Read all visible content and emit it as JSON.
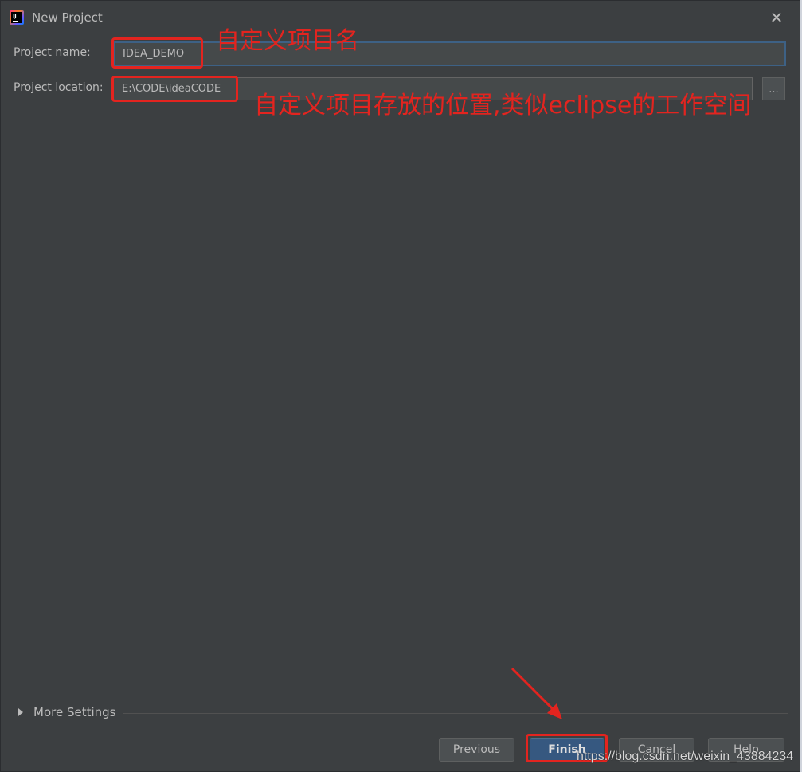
{
  "window": {
    "title": "New Project",
    "close_glyph": "✕"
  },
  "form": {
    "name_label": "Project name:",
    "name_value": "IDEA_DEMO",
    "location_label": "Project location:",
    "location_value": "E:\\CODE\\ideaCODE",
    "browse_label": "..."
  },
  "annotations": {
    "name_note": "自定义项目名",
    "location_note": "自定义项目存放的位置,类似eclipse的工作空间",
    "color": "#e3241f"
  },
  "more_settings": {
    "label": "More Settings"
  },
  "buttons": {
    "previous": "Previous",
    "finish": "Finish",
    "cancel": "Cancel",
    "help": "Help"
  },
  "watermark": "https://blog.csdn.net/weixin_43884234",
  "icons": {
    "app": "intellij-idea-icon",
    "close": "close-icon",
    "expand": "triangle-right-icon",
    "arrow": "red-arrow-icon"
  }
}
